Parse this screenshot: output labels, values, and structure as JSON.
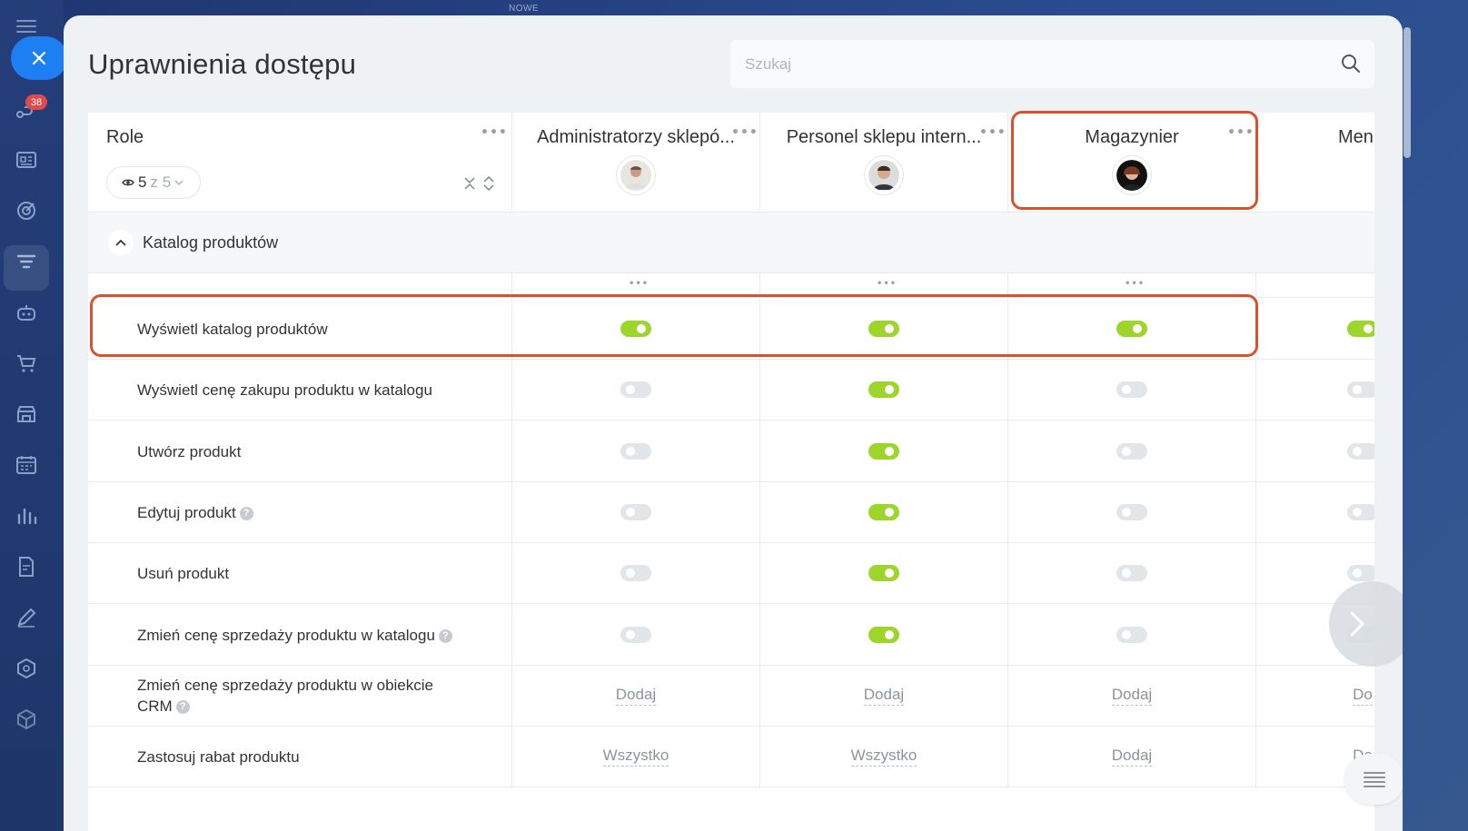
{
  "top_mark": "NOWE",
  "sidebar": {
    "badge": "38",
    "icons": [
      "close-icon",
      "activity-icon",
      "newspaper-icon",
      "target-icon",
      "filter-icon",
      "robot-icon",
      "cart-icon",
      "store-icon",
      "calendar-icon",
      "chart-icon",
      "document-icon",
      "pen-icon",
      "hexagon-icon",
      "cube-icon"
    ]
  },
  "page": {
    "title": "Uprawnienia dostępu",
    "search_placeholder": "Szukaj"
  },
  "table": {
    "role_header": "Role",
    "filter": {
      "count": "5",
      "of": "z 5"
    },
    "columns": [
      {
        "title": "Administratorzy sklepó...",
        "avatar": "male-avatar-1"
      },
      {
        "title": "Personel sklepu intern...",
        "avatar": "male-avatar-2"
      },
      {
        "title": "Magazynier",
        "avatar": "female-avatar"
      },
      {
        "title": "Men",
        "avatar": ""
      }
    ],
    "section": {
      "label": "Katalog produktów",
      "expanded": true
    },
    "rows": [
      {
        "label": "Wyświetl katalog produktów",
        "help": false,
        "cells": [
          "on",
          "on",
          "on",
          "on"
        ]
      },
      {
        "label": "Wyświetl cenę zakupu produktu w katalogu",
        "help": false,
        "cells": [
          "off",
          "on",
          "off",
          "off"
        ]
      },
      {
        "label": "Utwórz produkt",
        "help": false,
        "cells": [
          "off",
          "on",
          "off",
          "off"
        ]
      },
      {
        "label": "Edytuj produkt",
        "help": true,
        "cells": [
          "off",
          "on",
          "off",
          "off"
        ]
      },
      {
        "label": "Usuń produkt",
        "help": false,
        "cells": [
          "off",
          "on",
          "off",
          "off"
        ]
      },
      {
        "label": "Zmień cenę sprzedaży produktu w katalogu",
        "help": true,
        "cells": [
          "off",
          "on",
          "off",
          "off"
        ]
      },
      {
        "label": "Zmień cenę sprzedaży produktu w obiekcie CRM",
        "help": true,
        "cells": [
          "Dodaj",
          "Dodaj",
          "Dodaj",
          "Do"
        ]
      },
      {
        "label": "Zastosuj rabat produktu",
        "help": false,
        "cells": [
          "Wszystko",
          "Wszystko",
          "Dodaj",
          "Do"
        ]
      }
    ]
  },
  "colors": {
    "accent": "#1d7ff2",
    "toggle_on": "#9dd52b",
    "highlight": "#d9522c"
  }
}
